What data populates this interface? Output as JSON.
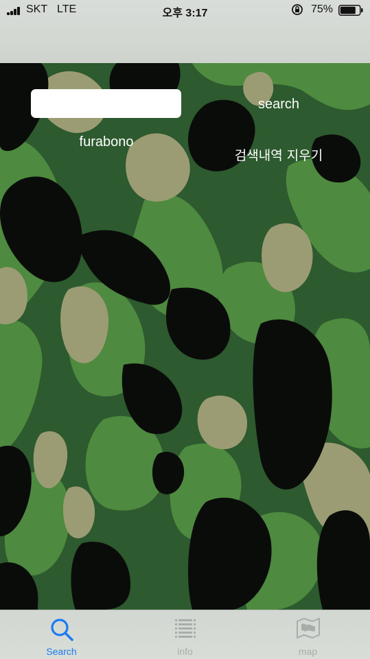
{
  "status_bar": {
    "carrier": "SKT",
    "network": "LTE",
    "time": "오후 3:17",
    "battery_percent": "75%"
  },
  "main": {
    "search_field": {
      "value": "",
      "placeholder": ""
    },
    "search_button_label": "search",
    "history_item": "furabono",
    "clear_history_label": "검색내역 지우기"
  },
  "tab_bar": {
    "tabs": [
      {
        "label": "Search",
        "icon": "search-icon",
        "active": true
      },
      {
        "label": "info",
        "icon": "list-icon",
        "active": false
      },
      {
        "label": "map",
        "icon": "map-icon",
        "active": false
      }
    ],
    "active_color": "#1a7cf0",
    "inactive_color": "#a9ada9"
  },
  "colors": {
    "camo_dark_green": "#2d5a2e",
    "camo_light_green": "#4e8a3f",
    "camo_tan": "#9c9c74",
    "camo_black": "#0a0c0a"
  }
}
